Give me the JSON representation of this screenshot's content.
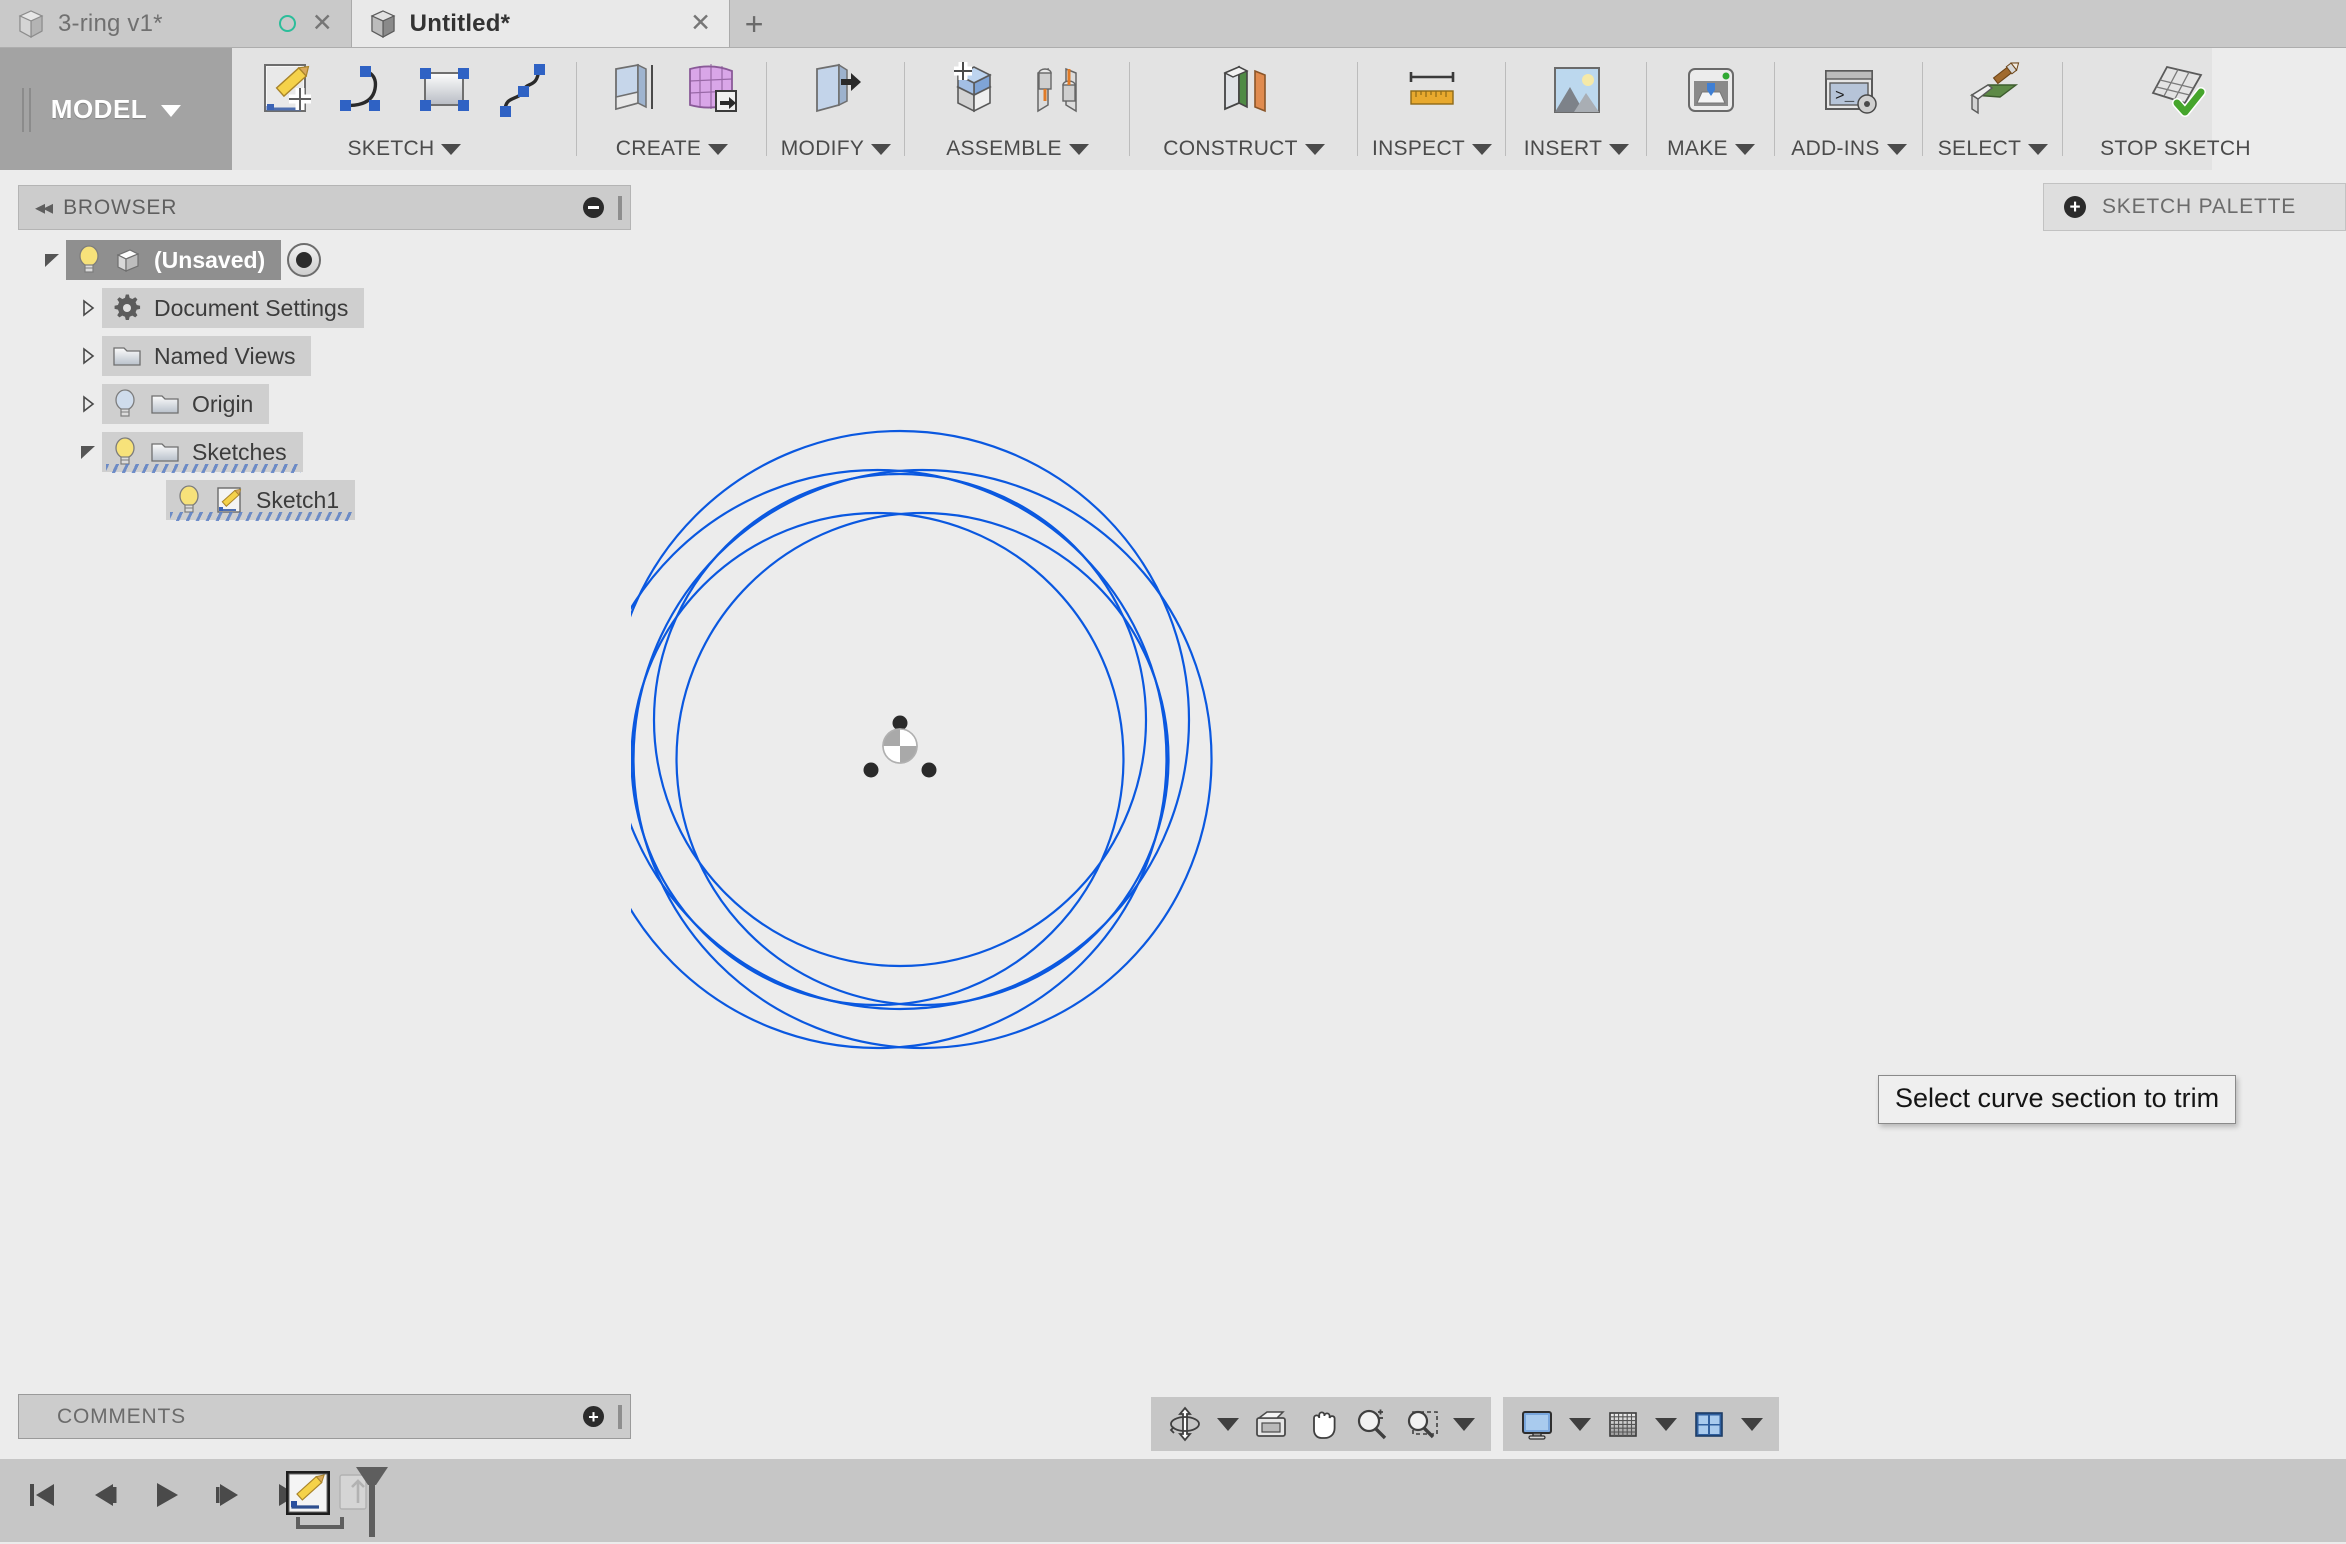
{
  "tabs": [
    {
      "label": "3-ring v1*",
      "state": "inactive",
      "icon": "cube-icon",
      "has_sync_dot": true,
      "close": "✕"
    },
    {
      "label": "Untitled*",
      "state": "active",
      "icon": "cube-icon",
      "has_sync_dot": false,
      "close": "✕"
    }
  ],
  "tabbar": {
    "new_tab_label": "+"
  },
  "ribbon": {
    "workspace_label": "MODEL",
    "panels": [
      {
        "label": "SKETCH",
        "has_caret": true,
        "icons": [
          "create-sketch-icon",
          "line-icon",
          "rectangle-icon",
          "spline-icon"
        ]
      },
      {
        "label": "CREATE",
        "has_caret": true,
        "icons": [
          "extrude-icon",
          "revolve-icon"
        ]
      },
      {
        "label": "MODIFY",
        "has_caret": true,
        "icons": [
          "press-pull-icon"
        ]
      },
      {
        "label": "ASSEMBLE",
        "has_caret": true,
        "icons": [
          "new-component-icon",
          "joint-icon"
        ]
      },
      {
        "label": "CONSTRUCT",
        "has_caret": true,
        "icons": [
          "offset-plane-icon"
        ]
      },
      {
        "label": "INSPECT",
        "has_caret": true,
        "icons": [
          "measure-icon"
        ]
      },
      {
        "label": "INSERT",
        "has_caret": true,
        "icons": [
          "insert-image-icon"
        ]
      },
      {
        "label": "MAKE",
        "has_caret": true,
        "icons": [
          "3d-print-icon"
        ]
      },
      {
        "label": "ADD-INS",
        "has_caret": true,
        "icons": [
          "scripts-addins-icon"
        ]
      },
      {
        "label": "SELECT",
        "has_caret": true,
        "icons": [
          "select-paint-icon"
        ]
      },
      {
        "label": "STOP SKETCH",
        "has_caret": false,
        "icons": [
          "stop-sketch-icon"
        ]
      }
    ]
  },
  "browser": {
    "title": "BROWSER",
    "collapse_icon": "double-chevron-left-icon",
    "minimize_icon": "minimize-icon",
    "tree": [
      {
        "label": "(Unsaved)",
        "indent": 0,
        "arrow": "expanded",
        "selected": true,
        "icons": [
          "lightbulb-on-icon",
          "document-cube-icon"
        ],
        "trailing_icon": "radio-marker-icon",
        "hatched": false
      },
      {
        "label": "Document Settings",
        "indent": 1,
        "arrow": "collapsed",
        "selected": false,
        "icons": [
          "gear-icon"
        ],
        "trailing_icon": null,
        "hatched": false
      },
      {
        "label": "Named Views",
        "indent": 1,
        "arrow": "collapsed",
        "selected": false,
        "icons": [
          "folder-icon"
        ],
        "trailing_icon": null,
        "hatched": false
      },
      {
        "label": "Origin",
        "indent": 1,
        "arrow": "collapsed",
        "selected": false,
        "icons": [
          "lightbulb-off-icon",
          "folder-icon"
        ],
        "trailing_icon": null,
        "hatched": false
      },
      {
        "label": "Sketches",
        "indent": 1,
        "arrow": "expanded",
        "selected": false,
        "icons": [
          "lightbulb-on-icon",
          "folder-icon"
        ],
        "trailing_icon": null,
        "hatched": true
      },
      {
        "label": "Sketch1",
        "indent": 2,
        "arrow": "none",
        "selected": false,
        "icons": [
          "lightbulb-on-icon",
          "sketch-icon"
        ],
        "trailing_icon": null,
        "hatched": true
      }
    ]
  },
  "sketch_palette": {
    "title": "SKETCH PALETTE",
    "expand_icon": "plus-circle-icon"
  },
  "comments": {
    "title": "COMMENTS",
    "add_icon": "plus-circle-icon"
  },
  "canvas": {
    "tooltip": "Select curve section to trim",
    "sketch_color": "#0a58e0",
    "background": "#ececec",
    "origin_marker": "origin-point-icon",
    "construction_points": 3,
    "geometry_description": "three overlapping ring pairs rotated 120 degrees"
  },
  "navbar": {
    "groups": [
      {
        "items": [
          {
            "icon": "orbit-icon",
            "caret": true
          },
          {
            "icon": "look-at-icon",
            "caret": false
          },
          {
            "icon": "pan-icon",
            "caret": false
          },
          {
            "icon": "zoom-icon",
            "caret": false
          },
          {
            "icon": "zoom-window-icon",
            "caret": true
          }
        ]
      },
      {
        "items": [
          {
            "icon": "display-settings-icon",
            "caret": true
          },
          {
            "icon": "grid-snaps-icon",
            "caret": true
          },
          {
            "icon": "viewports-icon",
            "caret": true
          }
        ]
      }
    ]
  },
  "timeline": {
    "controls": [
      {
        "icon": "skip-to-start-icon"
      },
      {
        "icon": "step-back-icon"
      },
      {
        "icon": "play-icon"
      },
      {
        "icon": "step-forward-icon"
      },
      {
        "icon": "skip-to-end-icon"
      }
    ],
    "features": [
      {
        "icon": "sketch-feature-icon",
        "label": "Sketch1"
      }
    ],
    "marker_icon": "timeline-marker-icon"
  },
  "colors": {
    "sketch_blue": "#0a58e0",
    "tab_active_bg": "#e9e9e9",
    "tab_inactive_bg": "#c9c9c9",
    "ribbon_bg": "#e3e3e3",
    "workspace_btn_bg": "#a3a3a3",
    "panel_bg": "#cccccc",
    "canvas_bg": "#ececec",
    "sync_dot": "#2bbd9a",
    "timeline_bg": "#c6c6c6"
  }
}
